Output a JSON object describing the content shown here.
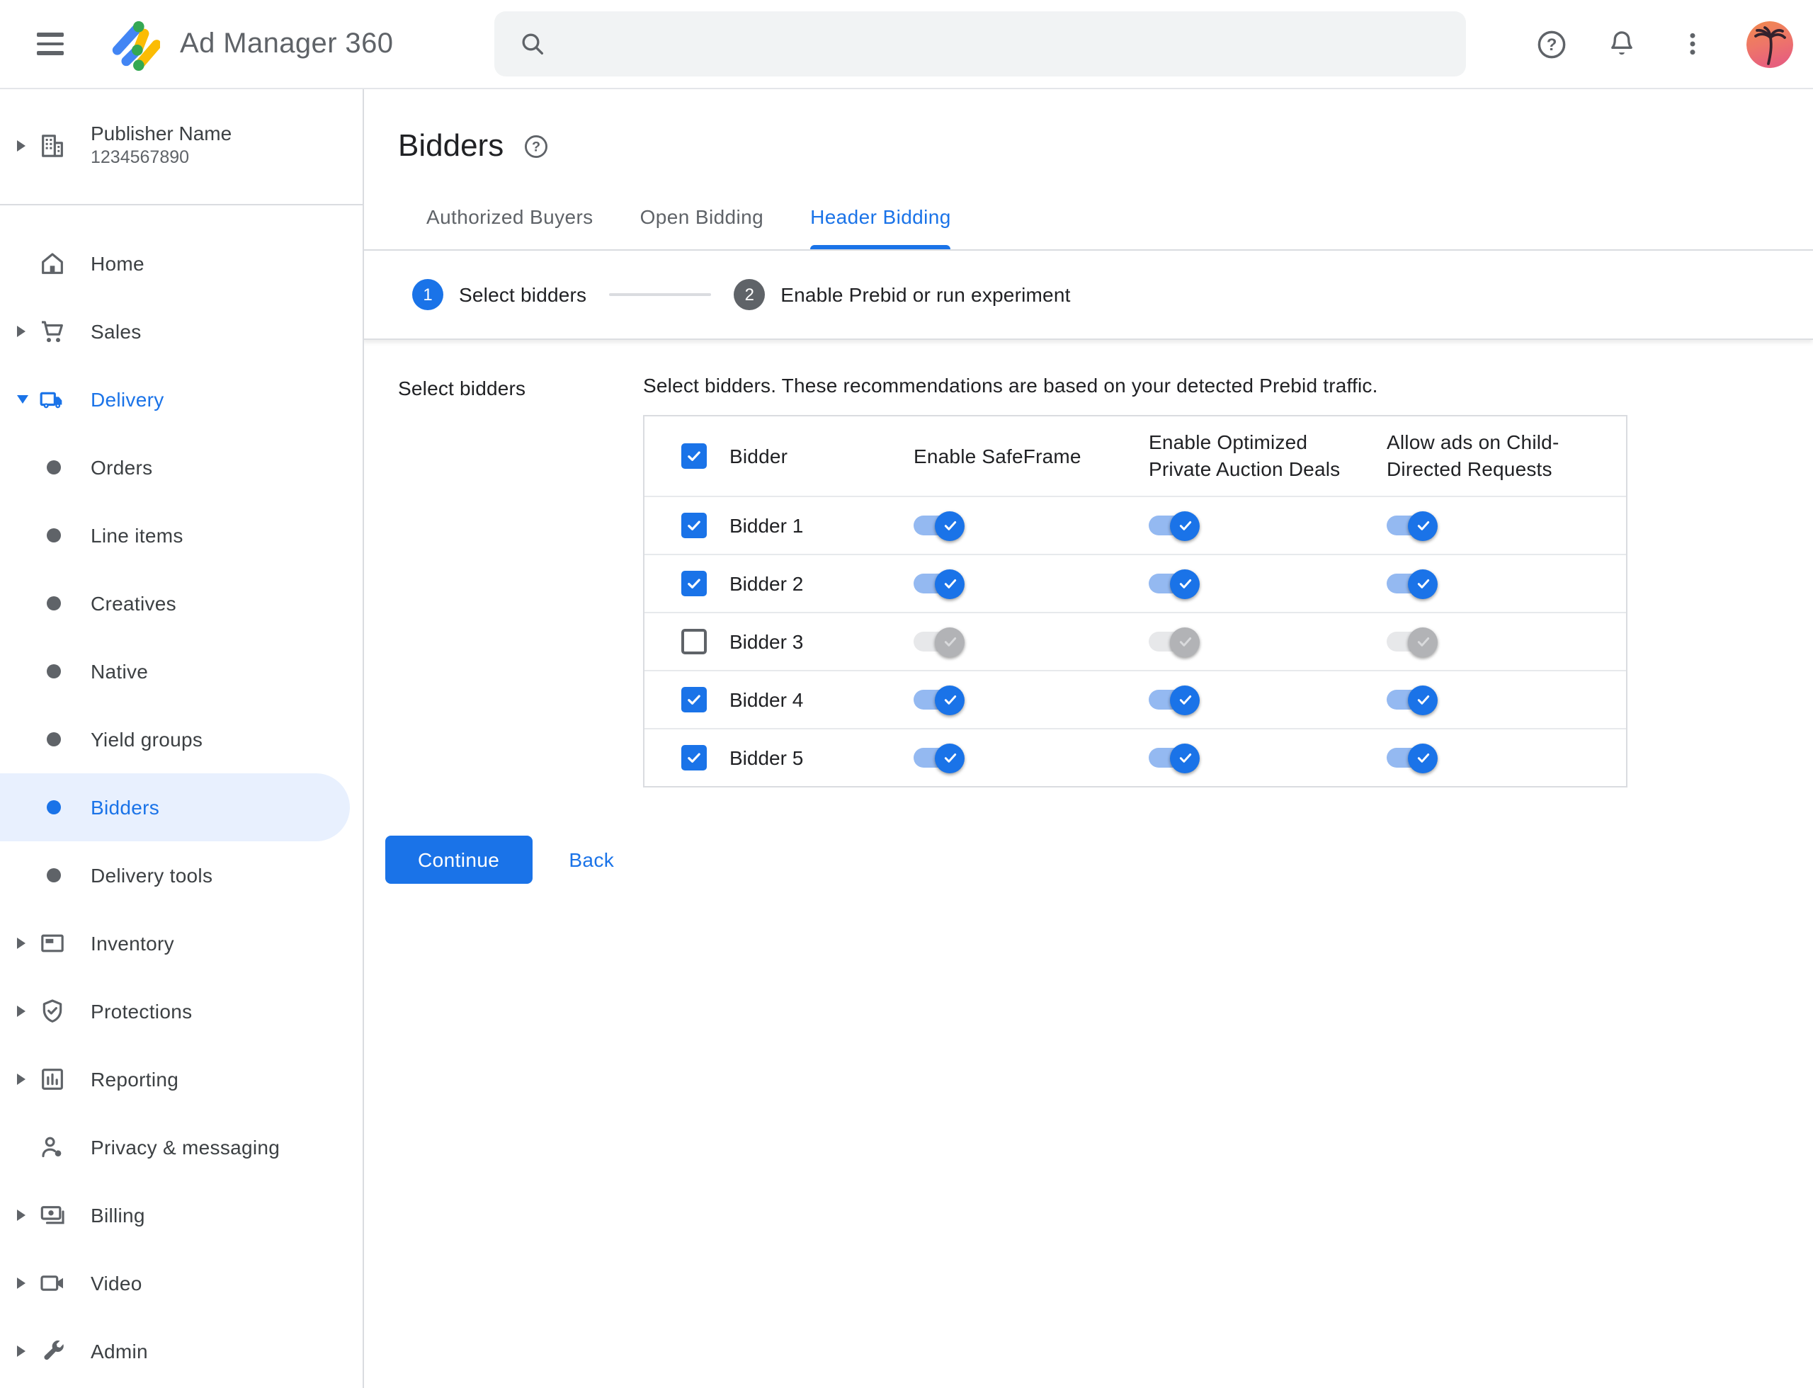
{
  "topbar": {
    "product_title": "Ad Manager 360",
    "search": {
      "placeholder": "",
      "value": ""
    },
    "icons": {
      "menu": "hamburger-icon",
      "logo": "ad-manager-logo",
      "search": "magnifier-icon",
      "help": "question-circle-icon",
      "notifications": "bell-icon",
      "more": "vertical-dots-icon",
      "avatar": "palm-tree-sunset-photo"
    }
  },
  "sidebar": {
    "publisher": {
      "name": "Publisher Name",
      "id": "1234567890",
      "icon": "building-icon"
    },
    "items": [
      {
        "label": "Home",
        "icon": "home-icon"
      },
      {
        "label": "Sales",
        "icon": "shopping-cart-icon",
        "expandable": true
      },
      {
        "label": "Delivery",
        "icon": "delivery-truck-icon",
        "expandable": true,
        "expanded": true,
        "active_section": true
      },
      {
        "label": "Orders",
        "icon": "bullet",
        "child": true
      },
      {
        "label": "Line items",
        "icon": "bullet",
        "child": true
      },
      {
        "label": "Creatives",
        "icon": "bullet",
        "child": true
      },
      {
        "label": "Native",
        "icon": "bullet",
        "child": true
      },
      {
        "label": "Yield groups",
        "icon": "bullet",
        "child": true
      },
      {
        "label": "Bidders",
        "icon": "bullet",
        "child": true,
        "selected": true
      },
      {
        "label": "Delivery tools",
        "icon": "bullet",
        "child": true
      },
      {
        "label": "Inventory",
        "icon": "ad-unit-icon",
        "expandable": true
      },
      {
        "label": "Protections",
        "icon": "shield-check-icon",
        "expandable": true
      },
      {
        "label": "Reporting",
        "icon": "bar-chart-icon",
        "expandable": true
      },
      {
        "label": "Privacy & messaging",
        "icon": "person-badge-icon"
      },
      {
        "label": "Billing",
        "icon": "payments-icon",
        "expandable": true
      },
      {
        "label": "Video",
        "icon": "video-camera-icon",
        "expandable": true
      },
      {
        "label": "Admin",
        "icon": "wrench-icon",
        "expandable": true
      }
    ]
  },
  "main": {
    "page_title": "Bidders",
    "tabs": [
      {
        "label": "Authorized Buyers",
        "active": false
      },
      {
        "label": "Open Bidding",
        "active": false
      },
      {
        "label": "Header Bidding",
        "active": true
      }
    ],
    "stepper": [
      {
        "number": "1",
        "label": "Select bidders",
        "active": true
      },
      {
        "number": "2",
        "label": "Enable Prebid or run experiment",
        "active": false
      }
    ],
    "section_label": "Select bidders",
    "description": "Select bidders. These recommendations are based on your detected Prebid traffic.",
    "table": {
      "columns": [
        "Bidder",
        "Enable SafeFrame",
        "Enable Optimized Private Auction Deals",
        "Allow ads on Child-Directed Requests"
      ],
      "header_checkbox_checked": true,
      "rows": [
        {
          "name": "Bidder 1",
          "checked": true,
          "safeframe": true,
          "optimized": true,
          "child_directed": true
        },
        {
          "name": "Bidder 2",
          "checked": true,
          "safeframe": true,
          "optimized": true,
          "child_directed": true
        },
        {
          "name": "Bidder 3",
          "checked": false,
          "safeframe": false,
          "optimized": false,
          "child_directed": false
        },
        {
          "name": "Bidder 4",
          "checked": true,
          "safeframe": true,
          "optimized": true,
          "child_directed": true
        },
        {
          "name": "Bidder 5",
          "checked": true,
          "safeframe": true,
          "optimized": true,
          "child_directed": true
        }
      ]
    },
    "actions": {
      "continue_label": "Continue",
      "back_label": "Back"
    },
    "colors": {
      "accent": "#1a73e8",
      "selected_pill": "#e8f0fe",
      "toggle_track_on": "#94b9f1",
      "border": "#dadce0"
    }
  }
}
